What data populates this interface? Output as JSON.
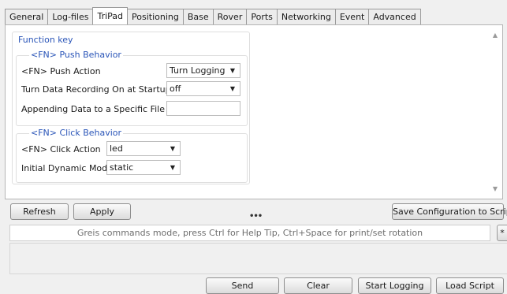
{
  "tabs": [
    "General",
    "Log-files",
    "TriPad",
    "Positioning",
    "Base",
    "Rover",
    "Ports",
    "Networking",
    "Event",
    "Advanced"
  ],
  "active_tab": "TriPad",
  "function_key": {
    "title": "Function key",
    "push_behavior": {
      "title": "<FN> Push Behavior",
      "push_action_label": "<FN> Push Action",
      "push_action_value": "Turn Logging",
      "turn_data_recording_label": "Turn Data Recording On at Startup",
      "turn_data_recording_value": "off",
      "appending_data_label": "Appending Data to a Specific File",
      "appending_data_value": ""
    },
    "click_behavior": {
      "title": "<FN> Click Behavior",
      "click_action_label": "<FN> Click Action",
      "click_action_value": "led",
      "initial_dynamic_mode_label": "Initial Dynamic Mode",
      "initial_dynamic_mode_value": "static"
    }
  },
  "buttons": {
    "refresh": "Refresh",
    "apply": "Apply",
    "save_config": "Save Configuration to Script",
    "send": "Send",
    "clear": "Clear",
    "start_logging": "Start Logging",
    "load_script": "Load Script"
  },
  "command_bar": {
    "placeholder": "Greis commands mode, press Ctrl for Help Tip, Ctrl+Space for print/set rotation",
    "side_button": "*"
  },
  "splitter": "•••",
  "icons": {
    "scroll_up": "triangle-up",
    "scroll_down": "triangle-down",
    "dropdown": "triangle-down"
  }
}
